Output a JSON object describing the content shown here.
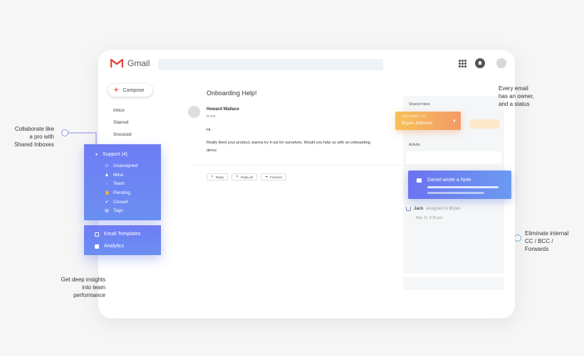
{
  "app": {
    "logo_text": "Gmail"
  },
  "compose": {
    "label": "Compose"
  },
  "nav": [
    "Inbox",
    "Starred",
    "Snoozed"
  ],
  "email": {
    "subject": "Onboarding Help!",
    "sender": "Howard Wallace",
    "to": "to me",
    "greeting": "Hi,",
    "body": "Really liked your product, wanna try it out for ourselves. Would you help us with an onboarding demo",
    "actions": [
      "Reply",
      "Reply all",
      "Forward"
    ]
  },
  "sidebar_panel": {
    "shared_inbox_label": "Shared Inbox",
    "assigned_label": "ASSIGNED TO",
    "assigned_name": "Bryan Johnson",
    "activity_label": "Activity",
    "note_text": "Daniel wrote a Note",
    "activity_actor": "Jack",
    "activity_text": "assigned to Bryan",
    "activity_time": "May 11, 8:15 pm"
  },
  "support": {
    "header": "Support (4)",
    "items": [
      {
        "icon": "unassigned-icon",
        "label": "Unassigned"
      },
      {
        "icon": "mine-icon",
        "label": "Mine"
      },
      {
        "icon": "team-icon",
        "label": "Team"
      },
      {
        "icon": "pending-icon",
        "label": "Pending"
      },
      {
        "icon": "closed-icon",
        "label": "Closed"
      },
      {
        "icon": "tags-icon",
        "label": "Tags"
      }
    ]
  },
  "extras": {
    "templates": "Email Templates",
    "analytics": "Analytics"
  },
  "callouts": {
    "collaborate": [
      "Collaborate like",
      "a pro with",
      "Shared Inboxes"
    ],
    "insights": [
      "Get deep insights",
      "into team",
      "performance"
    ],
    "owner": [
      "Every email",
      "has an owner,",
      "and a status"
    ],
    "eliminate": [
      "Eliminate internal",
      "CC / BCC /",
      "Forwards"
    ]
  },
  "colors": {
    "accent_blue": "#6e7cf4",
    "accent_orange": "#f39a66",
    "line_red": "#f0798a",
    "line_blue": "#67b6d6",
    "line_purple": "#8c8cf0"
  }
}
